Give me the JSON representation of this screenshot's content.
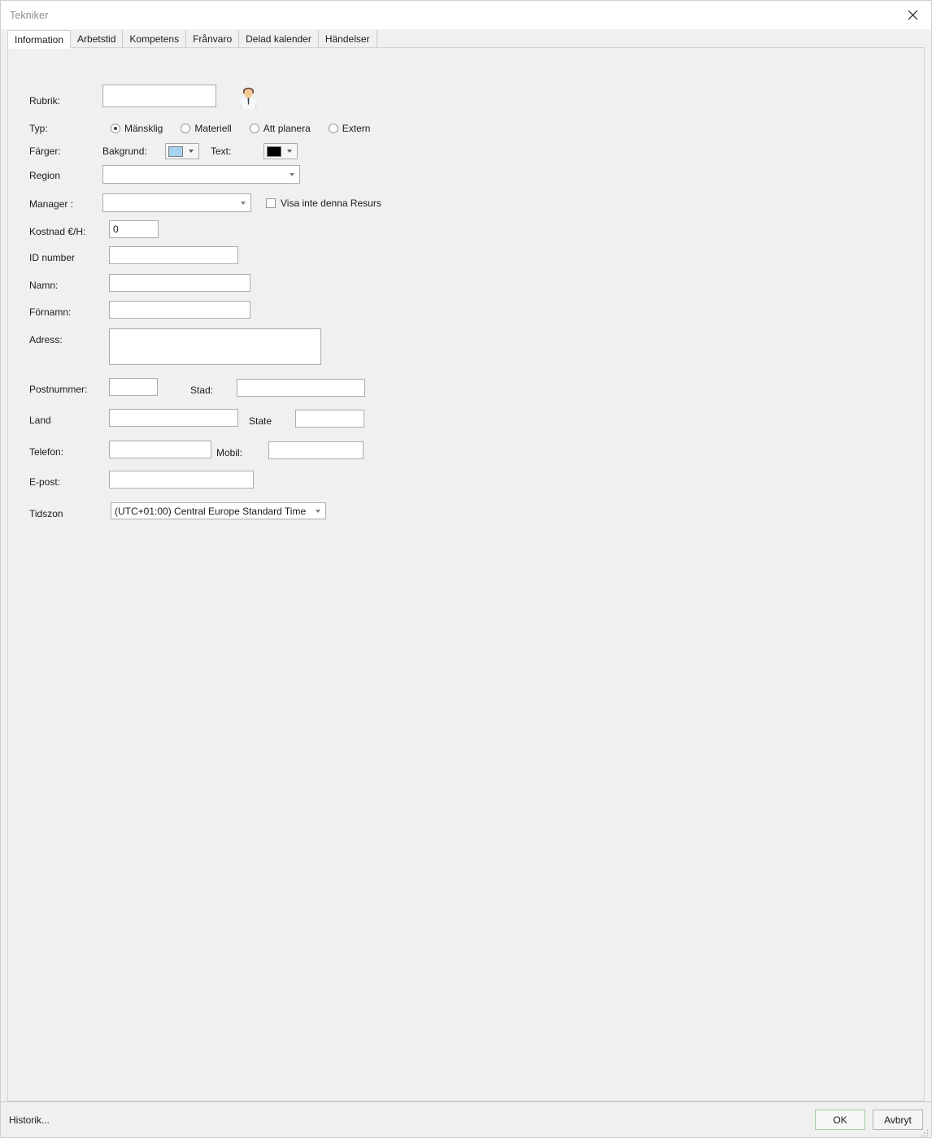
{
  "window": {
    "title": "Tekniker",
    "close_icon": "close-icon"
  },
  "tabs": [
    {
      "label": "Information",
      "active": true
    },
    {
      "label": "Arbetstid",
      "active": false
    },
    {
      "label": "Kompetens",
      "active": false
    },
    {
      "label": "Frånvaro",
      "active": false
    },
    {
      "label": "Delad kalender",
      "active": false
    },
    {
      "label": "Händelser",
      "active": false
    }
  ],
  "form": {
    "rubrik": {
      "label": "Rubrik:",
      "value": "",
      "placeholder": ""
    },
    "avatar": {
      "icon": "person-avatar-icon"
    },
    "typ": {
      "label": "Typ:",
      "options": [
        {
          "label": "Mänsklig",
          "selected": true
        },
        {
          "label": "Materiell",
          "selected": false
        },
        {
          "label": "Att planera",
          "selected": false
        },
        {
          "label": "Extern",
          "selected": false
        }
      ]
    },
    "farger": {
      "label": "Färger:",
      "background": {
        "label": "Bakgrund:",
        "color": "#A8D3F0"
      },
      "text": {
        "label": "Text:",
        "color": "#000000"
      }
    },
    "region": {
      "label": "Region",
      "value": ""
    },
    "manager": {
      "label": "Manager :",
      "value": ""
    },
    "hide_resource": {
      "label": "Visa inte denna Resurs",
      "checked": false
    },
    "kostnad": {
      "label": "Kostnad €/H:",
      "value": "0"
    },
    "id_number": {
      "label": "ID number",
      "value": ""
    },
    "namn": {
      "label": "Namn:",
      "value": ""
    },
    "fornamn": {
      "label": "Förnamn:",
      "value": ""
    },
    "adress": {
      "label": "Adress:",
      "value": ""
    },
    "postnummer": {
      "label": "Postnummer:",
      "value": ""
    },
    "stad": {
      "label": "Stad:",
      "value": ""
    },
    "land": {
      "label": "Land",
      "value": ""
    },
    "state": {
      "label": "State",
      "value": ""
    },
    "telefon": {
      "label": "Telefon:",
      "value": ""
    },
    "mobil": {
      "label": "Mobil:",
      "value": ""
    },
    "epost": {
      "label": "E-post:",
      "value": ""
    },
    "tidszon": {
      "label": "Tidszon",
      "value": "(UTC+01:00) Central Europe Standard Time"
    }
  },
  "footer": {
    "history_label": "Historik...",
    "ok_label": "OK",
    "cancel_label": "Avbryt"
  },
  "colors": {
    "dialog_bg": "#f0f0f0",
    "titlebar_bg": "#ffffff",
    "input_border": "#a5acb5",
    "default_button_border": "#a5c8a5",
    "title_text": "#8c8c8c"
  }
}
